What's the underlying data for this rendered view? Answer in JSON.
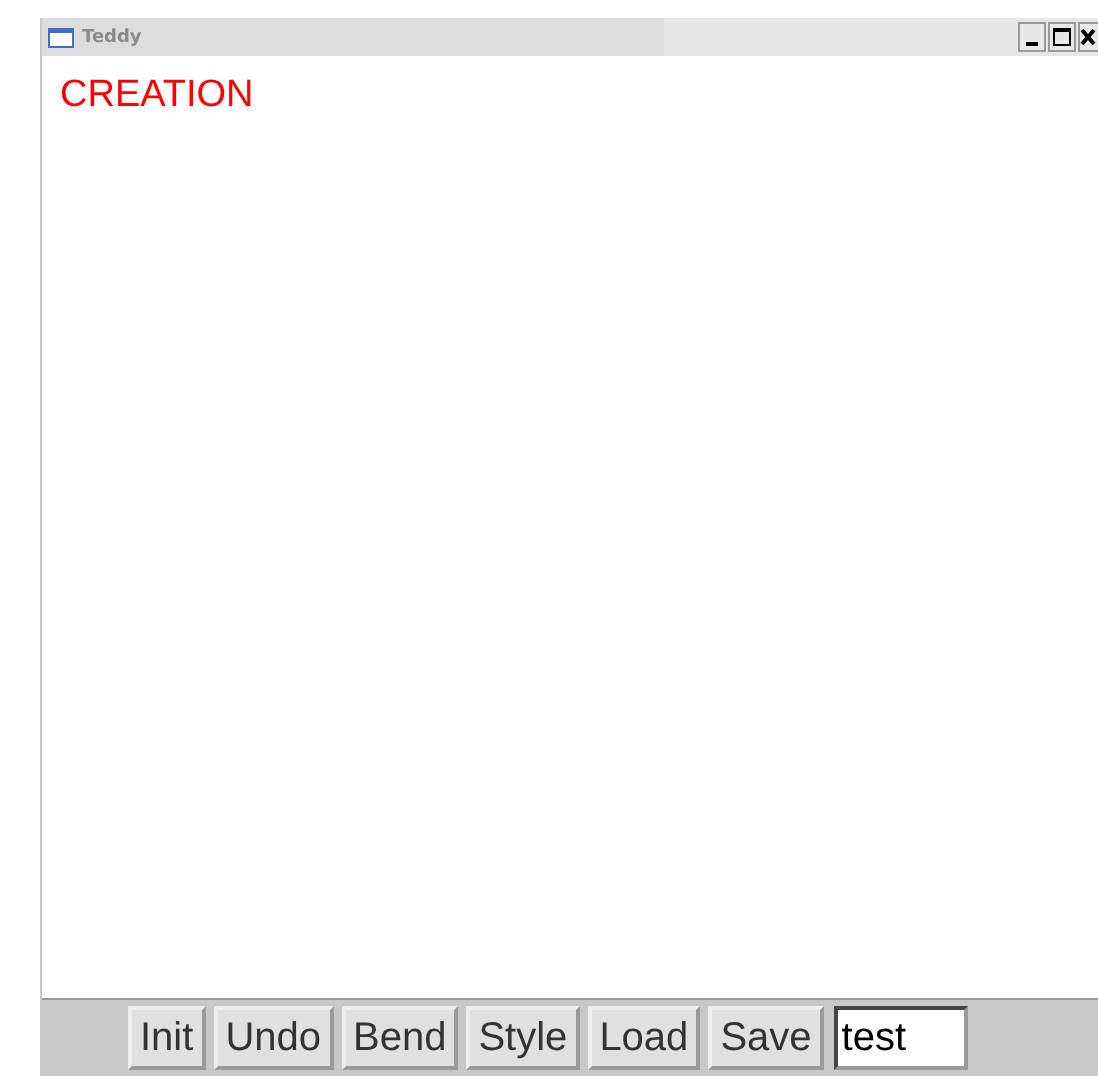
{
  "window": {
    "title": "Teddy"
  },
  "canvas": {
    "mode": "CREATION"
  },
  "toolbar": {
    "buttons": [
      {
        "label": "Init"
      },
      {
        "label": "Undo"
      },
      {
        "label": "Bend"
      },
      {
        "label": "Style"
      },
      {
        "label": "Load"
      },
      {
        "label": "Save"
      }
    ],
    "filename": {
      "value": "test"
    }
  }
}
